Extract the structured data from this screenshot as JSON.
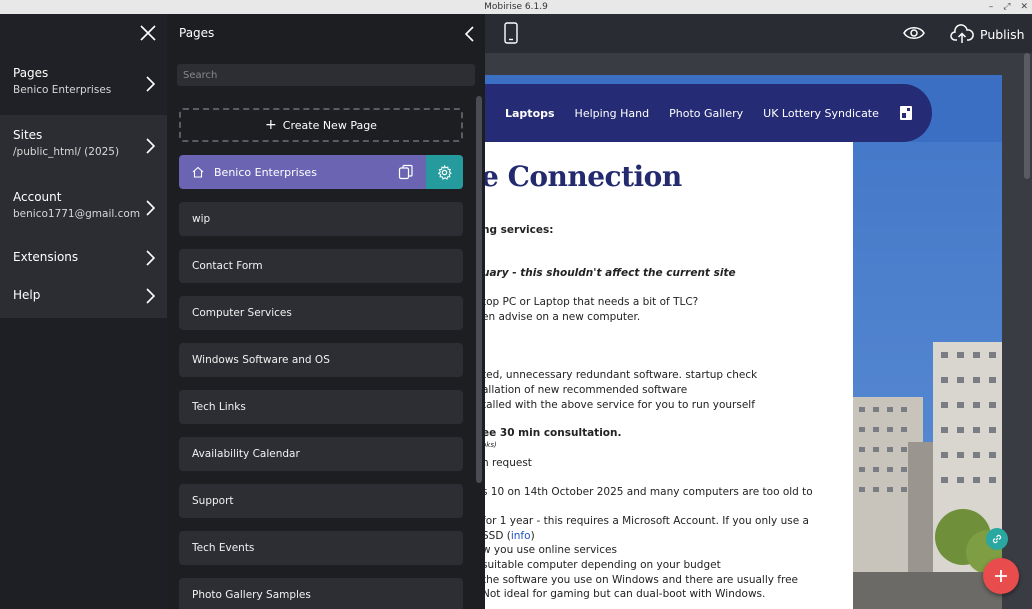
{
  "window": {
    "title": "Mobirise 6.1.9"
  },
  "colors": {
    "accent_page": "#6b64b3",
    "gear_bg": "#269b9d",
    "site_nav": "#252b75",
    "heading": "#232a6e",
    "fab_add": "#e94c4c"
  },
  "left_nav": {
    "items": [
      {
        "label": "Pages",
        "sub": "Benico Enterprises"
      },
      {
        "label": "Sites",
        "sub": "/public_html/ (2025)"
      },
      {
        "label": "Account",
        "sub": "benico1771@gmail.com"
      },
      {
        "label": "Extensions",
        "sub": ""
      },
      {
        "label": "Help",
        "sub": ""
      }
    ]
  },
  "pages_panel": {
    "title": "Pages",
    "search_placeholder": "Search",
    "create_label": "Create New Page",
    "active_page": "Benico Enterprises",
    "pages": [
      "wip",
      "Contact Form",
      "Computer Services",
      "Windows Software and OS",
      "Tech Links",
      "Availability Calendar",
      "Support",
      "Tech Events",
      "Photo Gallery Samples"
    ]
  },
  "toolbar": {
    "publish_label": "Publish"
  },
  "preview": {
    "nav": [
      "Laptops",
      "Helping Hand",
      "Photo Gallery",
      "UK Lottery Syndicate"
    ],
    "heading": "e Connection",
    "lines": [
      "ng services:",
      "uary - this shouldn't affect the current site",
      "top PC or Laptop that needs a bit of TLC?",
      "en advise on a new computer.",
      "ted, unnecessary redundant software. startup check",
      "allation of new recommended software",
      "talled with the above service for you to run yourself",
      "ee 30 min consultation.",
      "oks)",
      "n request",
      "s 10 on 14th October 2025 and many computers are too old to",
      "for 1 year - this requires a Microsoft Account. If you only use a",
      "SSD (",
      "info",
      ")",
      "w you use online services",
      "suitable computer depending on your budget",
      "the software you use on Windows and there are usually free",
      "Not ideal for gaming but can dual-boot with Windows."
    ]
  }
}
